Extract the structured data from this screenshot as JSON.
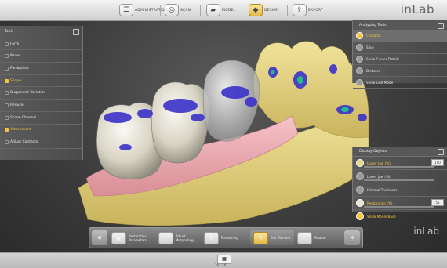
{
  "app": {
    "logo": "inLab",
    "logo_bottom": "inLab"
  },
  "workflow": {
    "steps": [
      {
        "label": "ADMINISTRATION",
        "icon": "administration-icon"
      },
      {
        "label": "SCAN",
        "icon": "scan-icon"
      },
      {
        "label": "MODEL",
        "icon": "model-icon"
      },
      {
        "label": "DESIGN",
        "icon": "design-icon"
      },
      {
        "label": "EXPORT",
        "icon": "export-icon"
      }
    ],
    "active_step": "DESIGN"
  },
  "tools_panel": {
    "title": "Tools",
    "items": [
      {
        "label": "Form"
      },
      {
        "label": "Move"
      },
      {
        "label": "Parabolide"
      },
      {
        "label": "Shape"
      },
      {
        "label": "Biogeneric Variation"
      },
      {
        "label": "Reduce"
      },
      {
        "label": "Screw Channel"
      },
      {
        "label": "Attachment"
      },
      {
        "label": "Adjust Contacts"
      }
    ]
  },
  "analyzing_panel": {
    "title": "Analyzing Tools",
    "items": [
      {
        "label": "Contacts",
        "selected": true
      },
      {
        "label": "Slice"
      },
      {
        "label": "Show Cursor Details"
      },
      {
        "label": "Distance"
      },
      {
        "label": "Show Grid Mode"
      }
    ]
  },
  "display_panel": {
    "title": "Display Objects",
    "items": [
      {
        "label": "Upper Jaw (%)",
        "value": "100"
      },
      {
        "label": "Lower Jaw (%)",
        "value": ""
      },
      {
        "label": "Minimal Thickness",
        "value": ""
      },
      {
        "label": "Restoration (%)",
        "value": "55"
      },
      {
        "label": "Show Model Base",
        "value": ""
      }
    ]
  },
  "phases": {
    "items": [
      {
        "label": "Restoration Parameters"
      },
      {
        "label": "Adjust Morphology"
      },
      {
        "label": "Positioning"
      },
      {
        "label": "Edit Element"
      },
      {
        "label": "Finalize"
      }
    ],
    "active": "Edit Element",
    "prev_arrow": "«",
    "next_arrow": "»"
  },
  "footer": {
    "page": "16 - 16"
  },
  "colors": {
    "accent": "#f5c542",
    "gingiva": "#f0a9b0",
    "model_stone": "#e8d68a",
    "contact_blue": "#3b32c8",
    "contact_teal": "#1fbf8a"
  }
}
